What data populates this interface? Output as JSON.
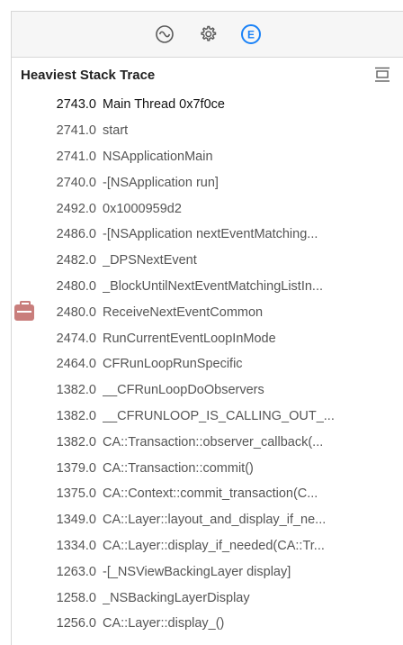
{
  "panel": {
    "title": "Heaviest Stack Trace"
  },
  "toolbar": {
    "icons": [
      "waveform-icon",
      "gear-icon",
      "extended-detail-icon"
    ],
    "active_color": "#1a82f7"
  },
  "trace": [
    {
      "weight": "2743.0",
      "symbol": "Main Thread  0x7f0ce"
    },
    {
      "weight": "2741.0",
      "symbol": "start"
    },
    {
      "weight": "2741.0",
      "symbol": "NSApplicationMain"
    },
    {
      "weight": "2740.0",
      "symbol": "-[NSApplication run]"
    },
    {
      "weight": "2492.0",
      "symbol": "0x1000959d2"
    },
    {
      "weight": "2486.0",
      "symbol": "-[NSApplication nextEventMatching..."
    },
    {
      "weight": "2482.0",
      "symbol": "_DPSNextEvent"
    },
    {
      "weight": "2480.0",
      "symbol": "_BlockUntilNextEventMatchingListIn..."
    },
    {
      "weight": "2480.0",
      "symbol": "ReceiveNextEventCommon"
    },
    {
      "weight": "2474.0",
      "symbol": "RunCurrentEventLoopInMode"
    },
    {
      "weight": "2464.0",
      "symbol": "CFRunLoopRunSpecific"
    },
    {
      "weight": "1382.0",
      "symbol": "__CFRunLoopDoObservers"
    },
    {
      "weight": "1382.0",
      "symbol": "__CFRUNLOOP_IS_CALLING_OUT_..."
    },
    {
      "weight": "1382.0",
      "symbol": "CA::Transaction::observer_callback(..."
    },
    {
      "weight": "1379.0",
      "symbol": "CA::Transaction::commit()"
    },
    {
      "weight": "1375.0",
      "symbol": "CA::Context::commit_transaction(C..."
    },
    {
      "weight": "1349.0",
      "symbol": "CA::Layer::layout_and_display_if_ne..."
    },
    {
      "weight": "1334.0",
      "symbol": "CA::Layer::display_if_needed(CA::Tr..."
    },
    {
      "weight": "1263.0",
      "symbol": "-[_NSViewBackingLayer display]"
    },
    {
      "weight": "1258.0",
      "symbol": "_NSBackingLayerDisplay"
    },
    {
      "weight": "1256.0",
      "symbol": "CA::Layer::display_()"
    }
  ]
}
